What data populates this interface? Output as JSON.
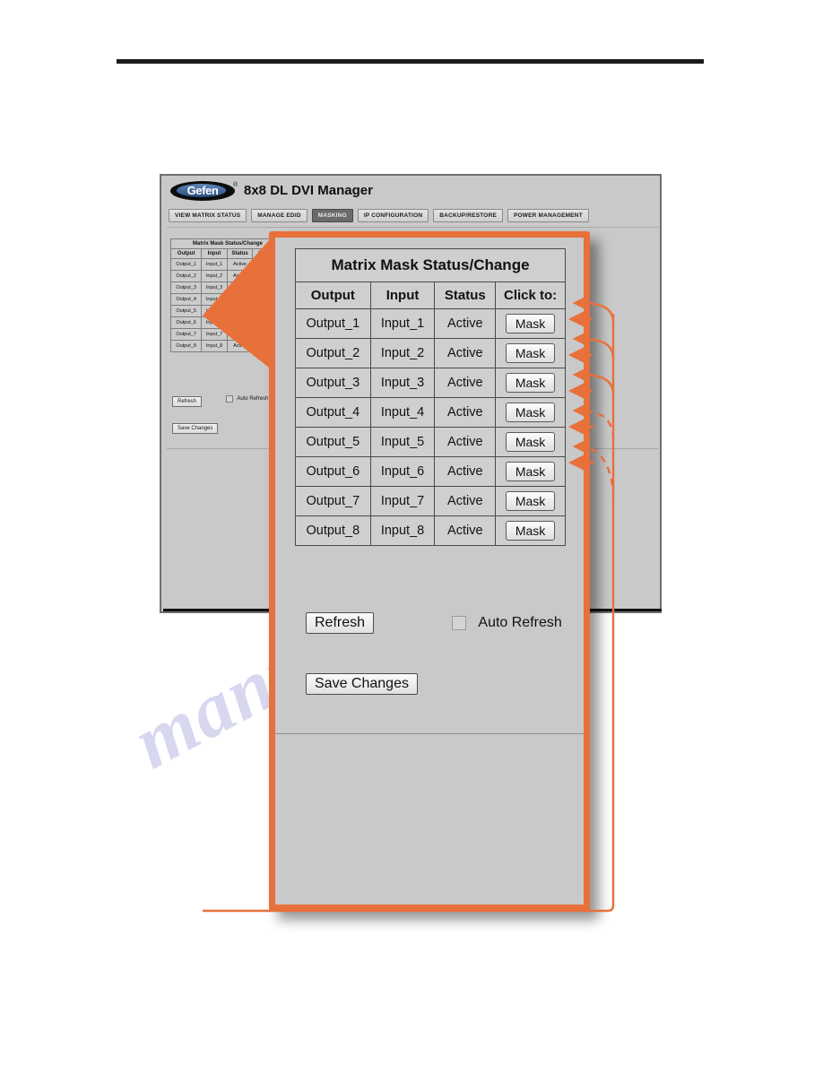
{
  "app": {
    "brand": "Gefen",
    "brand_reg": "®",
    "title": "8x8 DL DVI Manager",
    "tabs": [
      {
        "label": "VIEW MATRIX STATUS",
        "active": false
      },
      {
        "label": "MANAGE EDID",
        "active": false
      },
      {
        "label": "MASKING",
        "active": true
      },
      {
        "label": "IP CONFIGURATION",
        "active": false
      },
      {
        "label": "BACKUP/RESTORE",
        "active": false
      },
      {
        "label": "POWER MANAGEMENT",
        "active": false
      }
    ]
  },
  "panel": {
    "title": "Matrix Mask Status/Change",
    "columns": [
      "Output",
      "Input",
      "Status",
      "Click to:"
    ],
    "rows": [
      {
        "output": "Output_1",
        "input": "Input_1",
        "status": "Active",
        "action": "Mask"
      },
      {
        "output": "Output_2",
        "input": "Input_2",
        "status": "Active",
        "action": "Mask"
      },
      {
        "output": "Output_3",
        "input": "Input_3",
        "status": "Active",
        "action": "Mask"
      },
      {
        "output": "Output_4",
        "input": "Input_4",
        "status": "Active",
        "action": "Mask"
      },
      {
        "output": "Output_5",
        "input": "Input_5",
        "status": "Active",
        "action": "Mask"
      },
      {
        "output": "Output_6",
        "input": "Input_6",
        "status": "Active",
        "action": "Mask"
      },
      {
        "output": "Output_7",
        "input": "Input_7",
        "status": "Active",
        "action": "Mask"
      },
      {
        "output": "Output_8",
        "input": "Input_8",
        "status": "Active",
        "action": "Mask"
      }
    ],
    "refresh_label": "Refresh",
    "auto_refresh_label": "Auto Refresh",
    "auto_refresh_checked": false,
    "save_label": "Save Changes"
  },
  "callout": {
    "accent_color": "#e8703a",
    "arrow_targets": [
      1,
      2,
      3,
      4,
      5
    ],
    "dashed_targets": [
      4,
      5
    ]
  },
  "watermark": {
    "text": "manualshive"
  }
}
